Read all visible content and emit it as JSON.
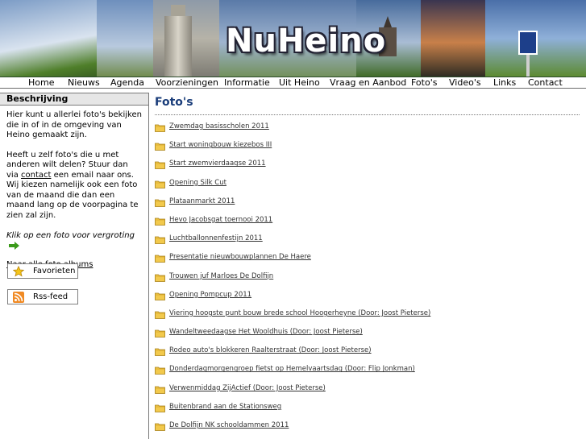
{
  "site": {
    "logo_text": "NuHeino"
  },
  "nav": {
    "items": [
      "Home",
      "Nieuws",
      "Agenda",
      "Voorzieningen",
      "Informatie",
      "Uit Heino",
      "Vraag en Aanbod",
      "Foto's",
      "Video's",
      "Links",
      "Contact"
    ]
  },
  "sidebar": {
    "heading": "Beschrijving",
    "intro": "Hier kunt u allerlei foto's bekijken die in of in de omgeving van Heino gemaakt zijn.",
    "share_before": "Heeft u zelf foto's die u met anderen wilt delen? Stuur dan via ",
    "share_link": "contact",
    "share_after": " een email naar ons. Wij kiezen namelijk ook een foto van de maand die dan een maand lang op de voorpagina te zien zal zijn.",
    "click_hint": "Klik op een foto voor vergroting",
    "all_albums_link": "Naar alle foto albums",
    "favorites_label": "Favorieten",
    "rss_label": "Rss-feed",
    "accent_arrow_color": "#3a9a1a"
  },
  "main": {
    "title": "Foto's",
    "albums": [
      "Zwemdag basisscholen 2011",
      "Start woningbouw kiezebos III",
      "Start zwemvierdaagse 2011",
      "Opening Silk Cut",
      "Plataanmarkt 2011",
      "Hevo Jacobsgat toernooi 2011",
      "Luchtballonnenfestijn 2011",
      "Presentatie nieuwbouwplannen De Haere",
      "Trouwen juf Marloes De Dolfijn",
      "Opening Pompcup 2011",
      "Viering hoogste punt bouw brede school Hoogerheyne (Door: Joost Pieterse)",
      "Wandeltweedaagse Het Wooldhuis (Door: Joost Pieterse)",
      "Rodeo auto's blokkeren Raalterstraat (Door: Joost Pieterse)",
      "Donderdagmorgengroep fietst op Hemelvaartsdag (Door: Flip Jonkman)",
      "Verwenmiddag ZijActief (Door: Joost Pieterse)",
      "Buitenbrand aan de Stationsweg",
      "De Dolfijn NK schooldammen 2011"
    ]
  },
  "colors": {
    "title_blue": "#1a3d7a",
    "folder_yellow": "#f2c94c"
  }
}
